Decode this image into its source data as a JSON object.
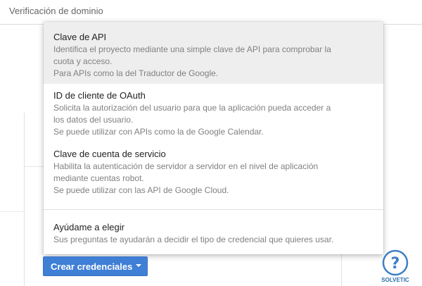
{
  "tab": {
    "label": "Verificación de dominio"
  },
  "menu": {
    "items": [
      {
        "title": "Clave de API",
        "desc": [
          "Identifica el proyecto mediante una simple clave de API para comprobar la",
          "cuota y acceso.",
          "Para APIs como la del Traductor de Google."
        ]
      },
      {
        "title": "ID de cliente de OAuth",
        "desc": [
          "Solicita la autorización del usuario para que la aplicación pueda acceder a",
          "los datos del usuario.",
          "Se puede utilizar con APIs como la de Google Calendar."
        ]
      },
      {
        "title": "Clave de cuenta de servicio",
        "desc": [
          "Habilita la autenticación de servidor a servidor en el nivel de aplicación",
          "mediante cuentas robot.",
          "Se puede utilizar con las API de Google Cloud."
        ]
      },
      {
        "title": "Ayúdame a elegir",
        "desc": [
          "Sus preguntas te ayudarán a decidir el tipo de credencial que quieres usar."
        ]
      }
    ]
  },
  "button": {
    "label": "Crear credenciales",
    "icon": "caret-down-icon",
    "color": "#3f7fd6"
  },
  "logo": {
    "text": "SOLVETIC",
    "icon": "question-mark-icon"
  }
}
